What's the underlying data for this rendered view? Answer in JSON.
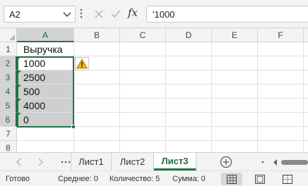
{
  "formula_bar": {
    "name_box": "A2",
    "formula_value": "'1000",
    "fx_label": "fx"
  },
  "columns": [
    "A",
    "B",
    "C",
    "D",
    "E",
    "F"
  ],
  "rows": [
    "1",
    "2",
    "3",
    "4",
    "5",
    "6",
    "7",
    "8"
  ],
  "cells": {
    "A1": "Выручка",
    "A2": "1000",
    "A3": "2500",
    "A4": "500",
    "A5": "4000",
    "A6": "0"
  },
  "sheet_tabs": [
    "Лист1",
    "Лист2",
    "Лист3"
  ],
  "active_sheet": "Лист3",
  "status": {
    "ready": "Готово",
    "average": "Среднее: 0",
    "count": "Количество: 5",
    "sum": "Сумма: 0"
  },
  "colors": {
    "accent": "#217346",
    "warning": "#f2b600",
    "error_indicator": "#1a7f37"
  },
  "icons": [
    "chevron-down-icon",
    "cancel-x-icon",
    "confirm-check-icon",
    "warning-icon",
    "add-sheet-icon",
    "normal-view-icon",
    "page-layout-icon",
    "page-break-icon"
  ]
}
